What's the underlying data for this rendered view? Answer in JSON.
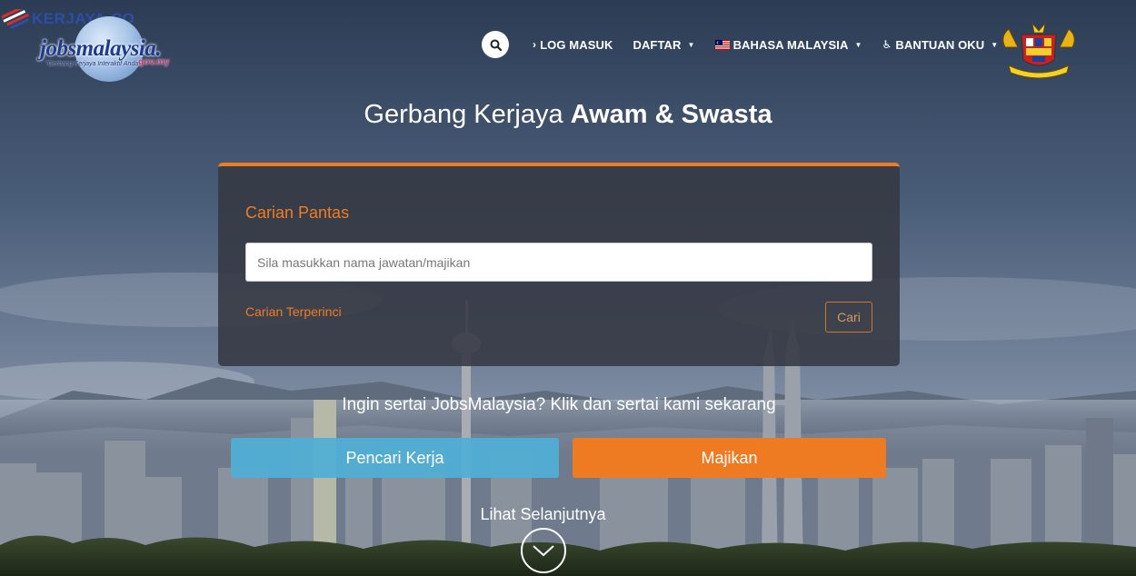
{
  "watermark": {
    "text": "KERJAYA.CO"
  },
  "logo": {
    "wordmark": "jobsmalaysia.",
    "tagline": "\"Gerbang Kerjaya Interaktif Anda\"",
    "suffix": "gov.my"
  },
  "nav": {
    "search_icon": "search-icon",
    "items": [
      {
        "label": "LOG MASUK",
        "prefix": "›",
        "has_caret": false
      },
      {
        "label": "DAFTAR",
        "prefix": "",
        "has_caret": true
      },
      {
        "label": "BAHASA MALAYSIA",
        "prefix": "flag-my",
        "has_caret": true
      },
      {
        "label": "BANTUAN OKU",
        "prefix": "♿",
        "has_caret": true
      }
    ]
  },
  "headline": {
    "light": "Gerbang Kerjaya ",
    "bold": "Awam & Swasta"
  },
  "search_panel": {
    "title": "Carian Pantas",
    "placeholder": "Sila masukkan nama jawatan/majikan",
    "value": "",
    "advanced_link": "Carian Terperinci",
    "submit_label": "Cari"
  },
  "join": {
    "text": "Ingin sertai JobsMalaysia? Klik dan sertai kami sekarang",
    "seeker_label": "Pencari Kerja",
    "employer_label": "Majikan"
  },
  "more": {
    "label": "Lihat Selanjutnya"
  },
  "colors": {
    "accent": "#f07b22",
    "seeker": "#4fafd6",
    "employer": "#ee7a22",
    "panel": "#343842"
  }
}
